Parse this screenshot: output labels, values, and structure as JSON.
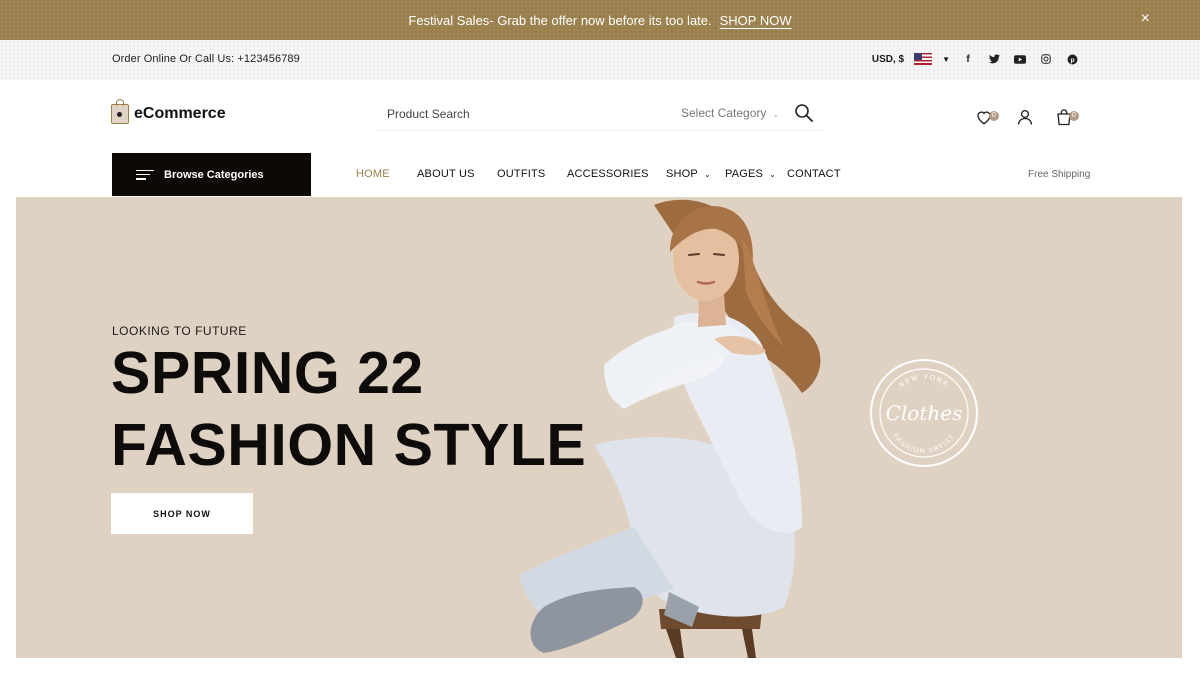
{
  "promo": {
    "message": "Festival Sales- Grab the offer now before its too late.",
    "link": "SHOP NOW",
    "close": "×",
    "bg_color": "#9a7f4c"
  },
  "utility": {
    "phone": "Order Online Or Call Us: +123456789",
    "currency": "USD, $",
    "flag": "us-flag-icon",
    "social": [
      {
        "name": "facebook-icon",
        "glyph": "f"
      },
      {
        "name": "twitter-icon",
        "glyph": "t"
      },
      {
        "name": "youtube-icon",
        "glyph": "▶"
      },
      {
        "name": "instagram-icon",
        "glyph": "◎"
      },
      {
        "name": "pinterest-icon",
        "glyph": "p"
      }
    ]
  },
  "header": {
    "logo": "eCommerce",
    "search_placeholder": "Product Search",
    "category_label": "Select Category",
    "wishlist_count": "0",
    "cart_count": "0"
  },
  "nav": {
    "browse": "Browse Categories",
    "items": [
      "HOME",
      "ABOUT US",
      "OUTFITS",
      "ACCESSORIES",
      "SHOP",
      "PAGES",
      "CONTACT"
    ],
    "active": "HOME",
    "free_shipping": "Free Shipping"
  },
  "hero": {
    "eyebrow": "LOOKING TO FUTURE",
    "title_line1": "SPRING 22",
    "title_line2": "FASHION STYLE",
    "cta": "SHOP NOW",
    "stamp": {
      "top": "NEW YORK",
      "center": "Clothes",
      "bottom": "FASHION ARTIST"
    },
    "bg_color": "#e0d2c3"
  }
}
